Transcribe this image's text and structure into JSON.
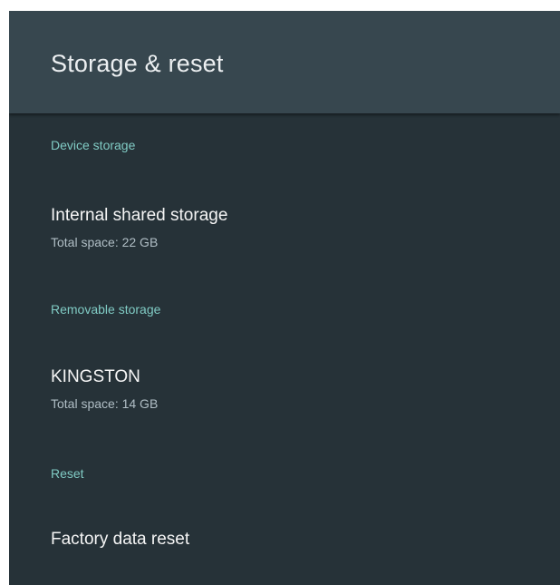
{
  "header": {
    "title": "Storage & reset"
  },
  "sections": [
    {
      "label": "Device storage",
      "items": [
        {
          "title": "Internal shared storage",
          "subtitle": "Total space: 22 GB"
        }
      ]
    },
    {
      "label": "Removable storage",
      "items": [
        {
          "title": "KINGSTON",
          "subtitle": "Total space: 14 GB"
        }
      ]
    },
    {
      "label": "Reset",
      "items": [
        {
          "title": "Factory data reset"
        }
      ]
    }
  ],
  "colors": {
    "background": "#263238",
    "header_background": "#37474f",
    "section_accent": "#80cbc4",
    "title_text": "#f5f5f5",
    "subtitle_text": "#b0bec5"
  }
}
